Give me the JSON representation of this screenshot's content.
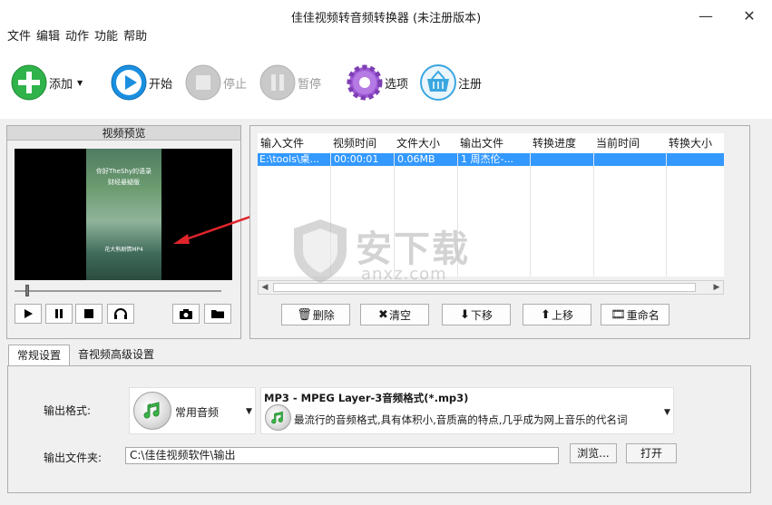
{
  "window": {
    "title": "佳佳视频转音频转换器  (未注册版本)",
    "minimize": "—",
    "close": "✕"
  },
  "menu": [
    "文件",
    "编辑",
    "动作",
    "功能",
    "帮助"
  ],
  "toolbar": {
    "add": "添加",
    "start": "开始",
    "stop": "停止",
    "pause": "暂停",
    "options": "选项",
    "register": "注册"
  },
  "preview": {
    "header": "视频预览",
    "video_caption_top": "你好TheShy的语录",
    "video_caption_sub": "财经悬疑版",
    "video_caption_bottom": "花大熊剧情MP4"
  },
  "file_list": {
    "columns": [
      "输入文件",
      "视频时间",
      "文件大小",
      "输出文件",
      "转换进度",
      "当前时间",
      "转换大小"
    ],
    "rows": [
      [
        "E:\\tools\\桌...",
        "00:00:01",
        "0.06MB",
        "1 周杰伦-...",
        "",
        "",
        ""
      ]
    ],
    "buttons": {
      "delete": "删除",
      "clear": "清空",
      "move_down": "下移",
      "move_up": "上移",
      "rename": "重命名"
    }
  },
  "watermark": {
    "main": "安下载",
    "sub": "anxz.com"
  },
  "tabs": [
    "常规设置",
    "音视频高级设置"
  ],
  "settings": {
    "format_label": "输出格式:",
    "format_category": "常用音频",
    "format_title": "MP3 - MPEG Layer-3音频格式(*.mp3)",
    "format_desc": "最流行的音频格式,具有体积小,音质高的特点,几乎成为网上音乐的代名词",
    "folder_label": "输出文件夹:",
    "folder_value": "C:\\佳佳视频软件\\输出",
    "browse": "浏览...",
    "open": "打开"
  },
  "colors": {
    "selection": "#3399ff",
    "add_icon": "#2fb34a",
    "play_icon": "#1a8fe0",
    "options_icon": "#a05bd8",
    "register_icon": "#3aa7e0",
    "arrow": "#e0242b"
  }
}
